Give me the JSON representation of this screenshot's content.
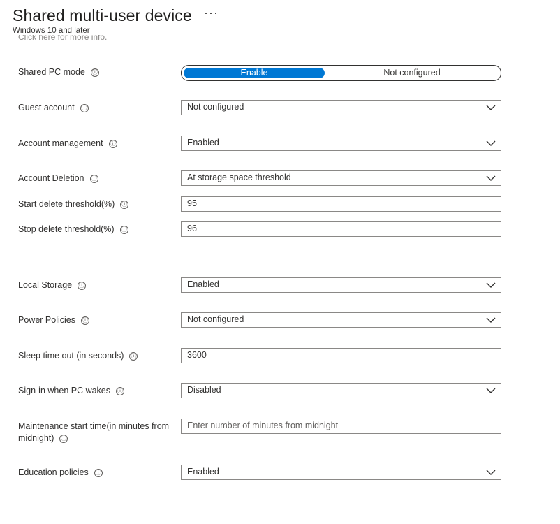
{
  "header": {
    "title": "Shared multi-user device",
    "more_label": "···",
    "subtitle": "Windows 10 and later",
    "cutoff_text": "Click here for more info."
  },
  "info_icon": "ⓘ",
  "fields": {
    "shared_pc_mode": {
      "label": "Shared PC mode",
      "options": [
        "Enable",
        "Not configured"
      ],
      "selected": "Enable"
    },
    "guest_account": {
      "label": "Guest account",
      "value": "Not configured"
    },
    "account_management": {
      "label": "Account management",
      "value": "Enabled"
    },
    "account_deletion": {
      "label": "Account Deletion",
      "value": "At storage space threshold"
    },
    "start_delete": {
      "label": "Start delete threshold(%)",
      "value": "95"
    },
    "stop_delete": {
      "label": "Stop delete threshold(%)",
      "value": "96"
    },
    "local_storage": {
      "label": "Local Storage",
      "value": "Enabled"
    },
    "power_policies": {
      "label": "Power Policies",
      "value": "Not configured"
    },
    "sleep_timeout": {
      "label": "Sleep time out (in seconds)",
      "value": "3600"
    },
    "signin_wakes": {
      "label": "Sign-in when PC wakes",
      "value": "Disabled"
    },
    "maintenance": {
      "label_line1": "Maintenance start time(in minutes from",
      "label_line2": "midnight)",
      "placeholder": "Enter number of minutes from midnight"
    },
    "education": {
      "label": "Education policies",
      "value": "Enabled"
    }
  },
  "colors": {
    "accent": "#0078d4",
    "border": "#8a8886",
    "text": "#323130"
  }
}
